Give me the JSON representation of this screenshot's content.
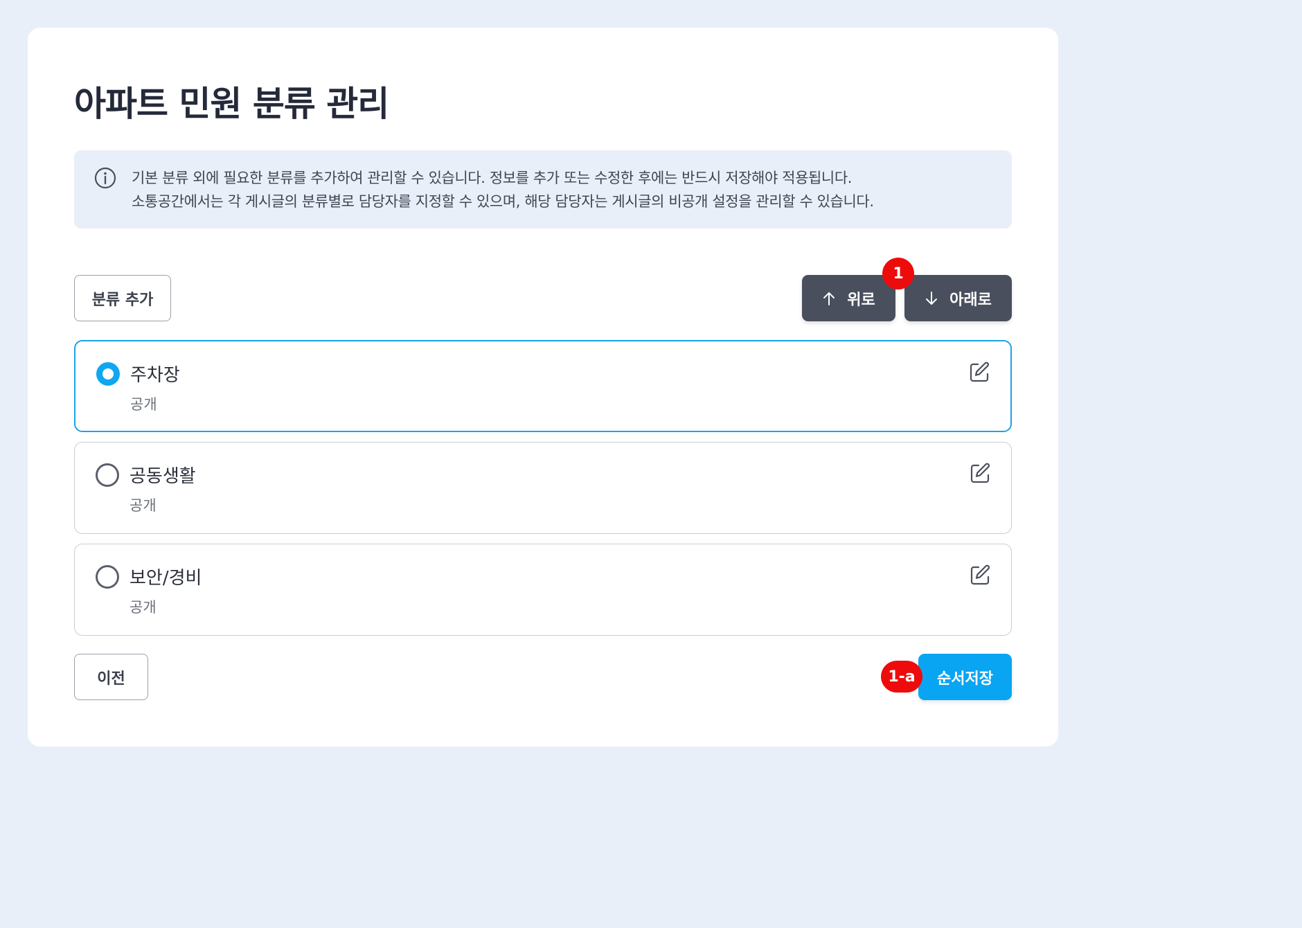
{
  "page": {
    "title": "아파트 민원 분류 관리"
  },
  "info": {
    "icon": "info-circle-icon",
    "line1": "기본 분류 외에 필요한 분류를 추가하여 관리할 수 있습니다. 정보를 추가 또는 수정한 후에는 반드시 저장해야 적용됩니다.",
    "line2": "소통공간에서는 각 게시글의 분류별로 담당자를 지정할 수 있으며, 해당 담당자는 게시글의 비공개 설정을 관리할 수 있습니다."
  },
  "toolbar": {
    "add_label": "분류 추가",
    "up_label": "위로",
    "down_label": "아래로",
    "up_icon": "arrow-up-icon",
    "down_icon": "arrow-down-icon"
  },
  "annotations": {
    "badge_1": "1",
    "badge_1a": "1-a"
  },
  "categories": [
    {
      "name": "주차장",
      "status": "공개",
      "selected": true
    },
    {
      "name": "공동생활",
      "status": "공개",
      "selected": false
    },
    {
      "name": "보안/경비",
      "status": "공개",
      "selected": false
    }
  ],
  "footer": {
    "prev_label": "이전",
    "save_label": "순서저장"
  },
  "colors": {
    "background": "#e9eff8",
    "primary": "#0aa5f2",
    "dark_button": "#4a4f5e",
    "badge": "#ee0b0b",
    "selected_border": "#1aa3e8"
  }
}
